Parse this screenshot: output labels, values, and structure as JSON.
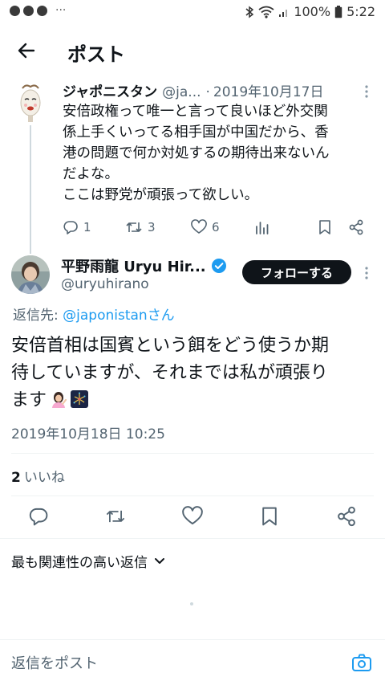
{
  "status_bar": {
    "battery": "100%",
    "time": "5:22",
    "more": "···"
  },
  "header": {
    "title": "ポスト"
  },
  "parent_tweet": {
    "name": "ジャポニスタン",
    "handle": "@ja...",
    "separator": "·",
    "date": "2019年10月17日",
    "body_lines": [
      "安倍政権って唯一と言って良いほど外交関",
      "係上手くいってる相手国が中国だから、香",
      "港の問題で何か対処するの期待出来ないん",
      "だよな。",
      "ここは野党が頑張って欲しい。"
    ],
    "replies": "1",
    "retweets": "3",
    "likes": "6"
  },
  "main_tweet": {
    "name": "平野雨龍 Uryu Hir...",
    "handle": "@uryuhirano",
    "follow_label": "フォローする",
    "reply_prefix": "返信先: ",
    "reply_mention": "@japonistan",
    "reply_suffix": "さん",
    "body_lines": [
      "安倍首相は国賓という餌をどう使うか期",
      "待していますが、それまでは私が頑張り",
      "ます"
    ],
    "emojis": [
      "woman-tipping-hand-icon",
      "fireworks-icon"
    ],
    "timestamp": "2019年10月18日 10:25",
    "likes_count": "2",
    "likes_label": "いいね"
  },
  "replies_sort": {
    "label": "最も関連性の高い返信"
  },
  "reply_box": {
    "placeholder": "返信をポスト"
  },
  "colors": {
    "accent": "#1d9bf0",
    "text": "#0f1419",
    "muted": "#536471",
    "follow_bg": "#0f1419"
  }
}
